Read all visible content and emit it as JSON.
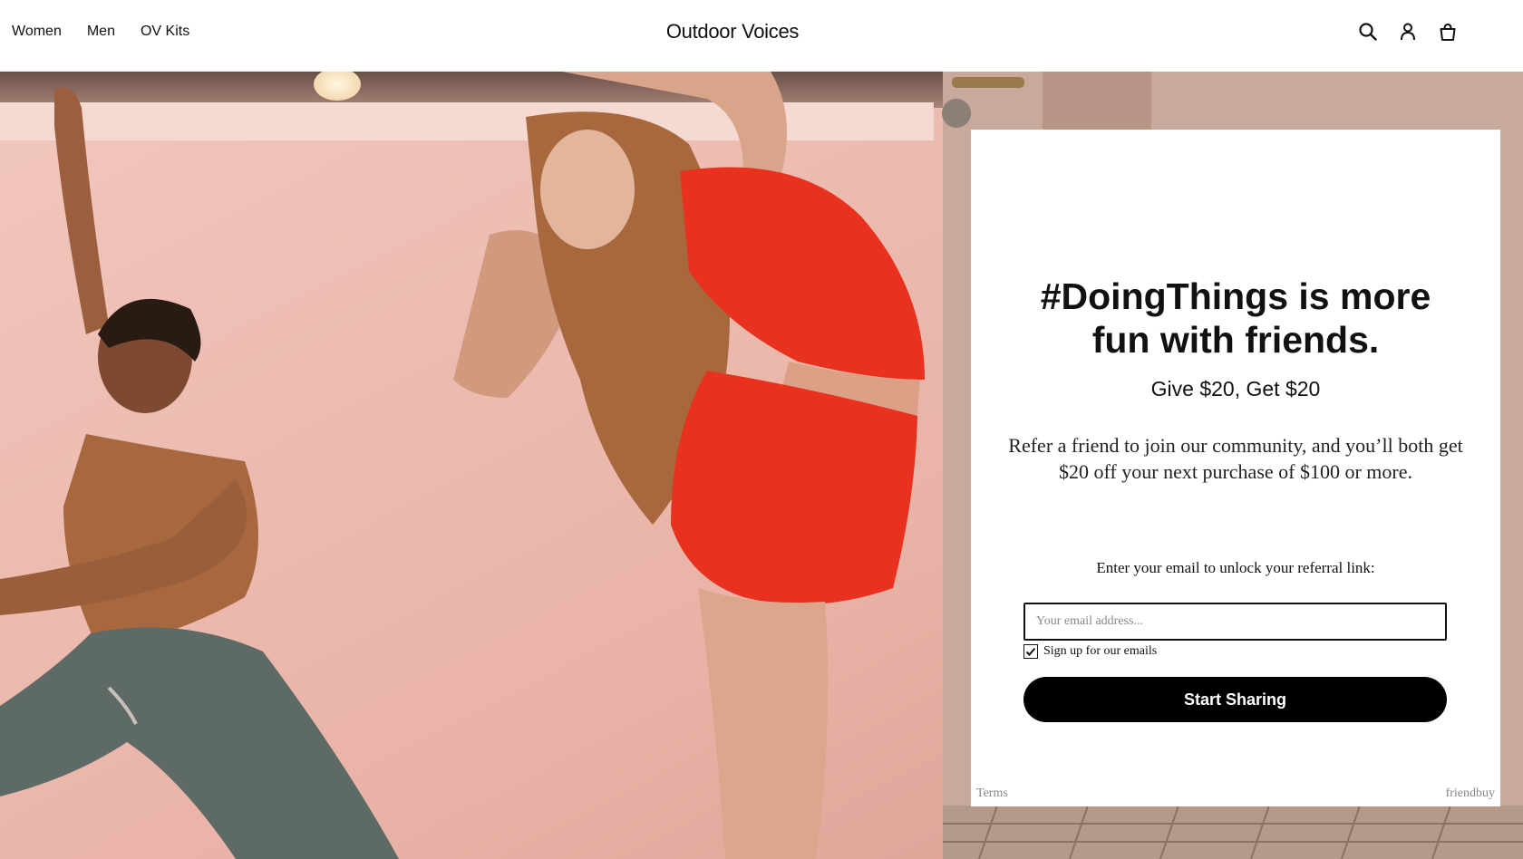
{
  "header": {
    "nav": [
      "Women",
      "Men",
      "OV Kits"
    ],
    "logo": "Outdoor Voices",
    "icons": [
      "search-icon",
      "account-icon",
      "bag-icon"
    ]
  },
  "hero": {
    "description": ""
  },
  "modal": {
    "title": "#DoingThings is more fun with friends.",
    "subtitle": "Give $20, Get $20",
    "body": "Refer a friend to join our community, and you’ll both get $20 off your next purchase of $100 or more.",
    "email_label": "Enter your email to unlock your referral link:",
    "email_placeholder": "Your email address...",
    "email_value": "",
    "checkbox_label": "Sign up for our emails",
    "checkbox_checked": true,
    "button_label": "Start Sharing",
    "footer_left": "Terms",
    "footer_right": "friendbuy"
  },
  "colors": {
    "accent": "#000000",
    "backdrop": "#e8b8ae",
    "outfit_red": "#e8311e"
  }
}
